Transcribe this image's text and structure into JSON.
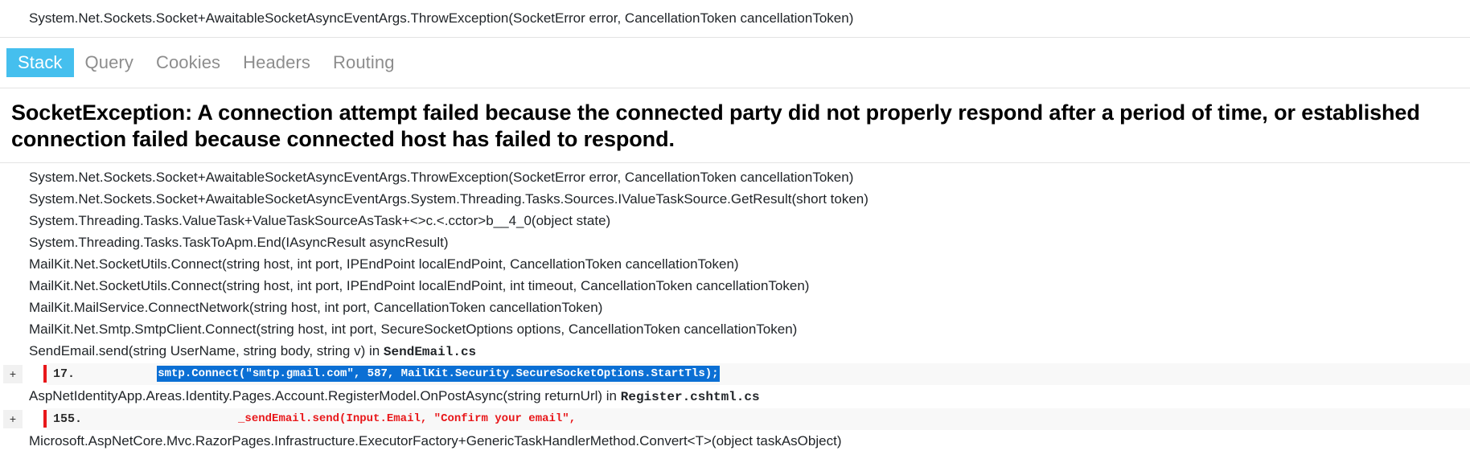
{
  "top_signature": "System.Net.Sockets.Socket+AwaitableSocketAsyncEventArgs.ThrowException(SocketError error, CancellationToken cancellationToken)",
  "tabs": [
    {
      "label": "Stack",
      "active": true
    },
    {
      "label": "Query",
      "active": false
    },
    {
      "label": "Cookies",
      "active": false
    },
    {
      "label": "Headers",
      "active": false
    },
    {
      "label": "Routing",
      "active": false
    }
  ],
  "exception": {
    "heading": "SocketException: A connection attempt failed because the connected party did not properly respond after a period of time, or established connection failed because connected host has failed to respond."
  },
  "stack": {
    "frames": [
      {
        "type": "frame",
        "text": "System.Net.Sockets.Socket+AwaitableSocketAsyncEventArgs.ThrowException(SocketError error, CancellationToken cancellationToken)"
      },
      {
        "type": "frame",
        "text": "System.Net.Sockets.Socket+AwaitableSocketAsyncEventArgs.System.Threading.Tasks.Sources.IValueTaskSource.GetResult(short token)"
      },
      {
        "type": "frame",
        "text": "System.Threading.Tasks.ValueTask+ValueTaskSourceAsTask+<>c.<.cctor>b__4_0(object state)"
      },
      {
        "type": "frame",
        "text": "System.Threading.Tasks.TaskToApm.End(IAsyncResult asyncResult)"
      },
      {
        "type": "frame",
        "text": "MailKit.Net.SocketUtils.Connect(string host, int port, IPEndPoint localEndPoint, CancellationToken cancellationToken)"
      },
      {
        "type": "frame",
        "text": "MailKit.Net.SocketUtils.Connect(string host, int port, IPEndPoint localEndPoint, int timeout, CancellationToken cancellationToken)"
      },
      {
        "type": "frame",
        "text": "MailKit.MailService.ConnectNetwork(string host, int port, CancellationToken cancellationToken)"
      },
      {
        "type": "frame",
        "text": "MailKit.Net.Smtp.SmtpClient.Connect(string host, int port, SecureSocketOptions options, CancellationToken cancellationToken)"
      },
      {
        "type": "frame",
        "text": "SendEmail.send(string UserName, string body, string v) in ",
        "file": "SendEmail.cs"
      },
      {
        "type": "source",
        "expander": "+",
        "line_number": "17.",
        "indent": "        ",
        "code": "smtp.Connect(\"smtp.gmail.com\", 587, MailKit.Security.SecureSocketOptions.StartTls);",
        "selected": true
      },
      {
        "type": "frame",
        "text": "AspNetIdentityApp.Areas.Identity.Pages.Account.RegisterModel.OnPostAsync(string returnUrl) in ",
        "file": "Register.cshtml.cs"
      },
      {
        "type": "source",
        "expander": "+",
        "line_number": "155.",
        "indent": "                    ",
        "code": "_sendEmail.send(Input.Email, \"Confirm your email\",",
        "selected": false
      },
      {
        "type": "frame",
        "text": "Microsoft.AspNetCore.Mvc.RazorPages.Infrastructure.ExecutorFactory+GenericTaskHandlerMethod.Convert<T>(object taskAsObject)"
      }
    ]
  },
  "colors": {
    "accent_tab": "#45bfee",
    "selection": "#0b6fd4",
    "code_red": "#e8171a",
    "divider": "#e3e3e3"
  }
}
